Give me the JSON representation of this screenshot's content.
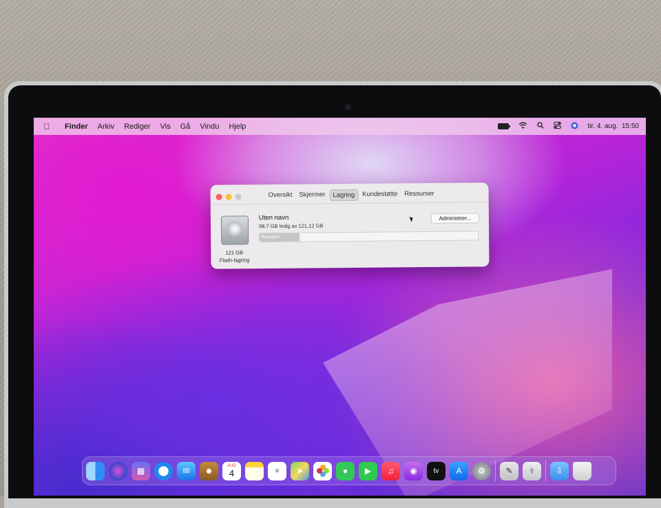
{
  "menubar": {
    "items": [
      "Finder",
      "Arkiv",
      "Rediger",
      "Vis",
      "Gå",
      "Vindu",
      "Hjelp"
    ],
    "datetime": "tir. 4. aug.  15:50"
  },
  "dialog": {
    "tabs": [
      "Oversikt",
      "Skjermer",
      "Lagring",
      "Kundestøtte",
      "Ressurser"
    ],
    "active_tab": "Lagring",
    "disk_size": "121 GB",
    "disk_type": "Flash-lagring",
    "volume_name": "Uten navn",
    "volume_free": "98,7 GB ledig av 121,12 GB",
    "progress_label": "Beregner...",
    "manage_button": "Administrer..."
  },
  "dock": {
    "calendar_month": "AUG",
    "calendar_day": "4",
    "tv_label": "tv"
  },
  "colors": {
    "close": "#ff5f57",
    "minimize": "#febc2e",
    "zoom": "#c9c7c9"
  }
}
